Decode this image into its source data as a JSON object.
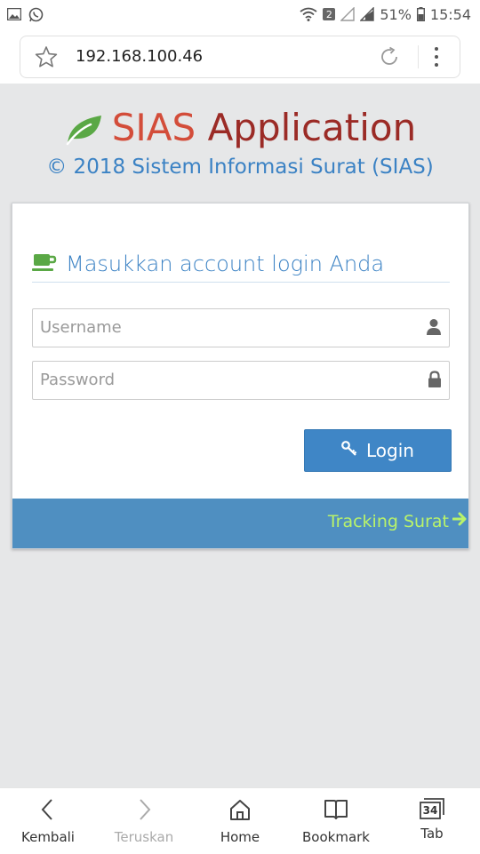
{
  "status_bar": {
    "badge": "2",
    "battery": "51%",
    "time": "15:54"
  },
  "browser": {
    "url": "192.168.100.46"
  },
  "header": {
    "title_part1": "SIAS",
    "title_part2": "Application",
    "subtitle": "© 2018 Sistem Informasi Surat (SIAS)"
  },
  "login_card": {
    "heading": "Masukkan account login Anda",
    "username_placeholder": "Username",
    "password_placeholder": "Password",
    "login_label": "Login",
    "tracking_label": "Tracking Surat"
  },
  "bottom_nav": {
    "items": [
      {
        "label": "Kembali",
        "icon": "chevron-left-icon"
      },
      {
        "label": "Teruskan",
        "icon": "chevron-right-icon"
      },
      {
        "label": "Home",
        "icon": "home-icon"
      },
      {
        "label": "Bookmark",
        "icon": "book-icon"
      },
      {
        "label": "Tab",
        "icon": "tabs-icon",
        "count": "34"
      }
    ]
  },
  "colors": {
    "accent_blue": "#3f86c6",
    "title_red": "#d34d3a",
    "title_dark_red": "#9b2b26",
    "tracking_green": "#b9f36a",
    "leaf_green": "#5aa845"
  }
}
